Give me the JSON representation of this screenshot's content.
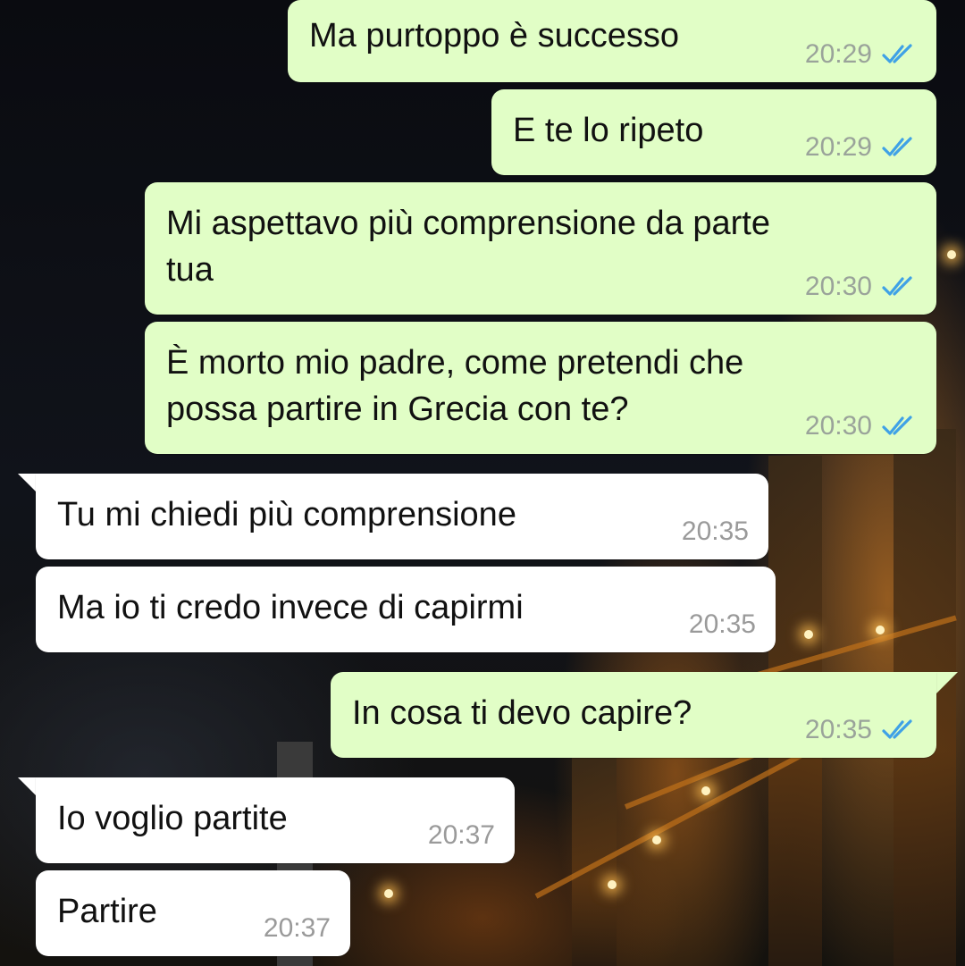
{
  "colors": {
    "outgoing_bubble": "#e1fec6",
    "incoming_bubble": "#ffffff",
    "read_ticks": "#3fa1e6",
    "timestamp": "#9aa39a"
  },
  "messages": [
    {
      "direction": "outgoing",
      "text": "Ma purtoppo è successo",
      "time": "20:29",
      "status": "read",
      "status_icon": "double-check-icon"
    },
    {
      "direction": "outgoing",
      "text": "E te lo ripeto",
      "time": "20:29",
      "status": "read",
      "status_icon": "double-check-icon"
    },
    {
      "direction": "outgoing",
      "text": "Mi aspettavo più comprensione da parte\ntua",
      "time": "20:30",
      "status": "read",
      "status_icon": "double-check-icon"
    },
    {
      "direction": "outgoing",
      "text": "È morto mio padre, come pretendi che\npossa partire in Grecia con te?",
      "time": "20:30",
      "status": "read",
      "status_icon": "double-check-icon"
    },
    {
      "direction": "incoming",
      "text": "Tu mi chiedi più comprensione",
      "time": "20:35"
    },
    {
      "direction": "incoming",
      "text": "Ma io ti credo invece di capirmi",
      "time": "20:35"
    },
    {
      "direction": "outgoing",
      "text": "In cosa ti devo capire?",
      "time": "20:35",
      "status": "read",
      "status_icon": "double-check-icon"
    },
    {
      "direction": "incoming",
      "text": "Io voglio partite",
      "time": "20:37"
    },
    {
      "direction": "incoming",
      "text": "Partire",
      "time": "20:37"
    }
  ]
}
